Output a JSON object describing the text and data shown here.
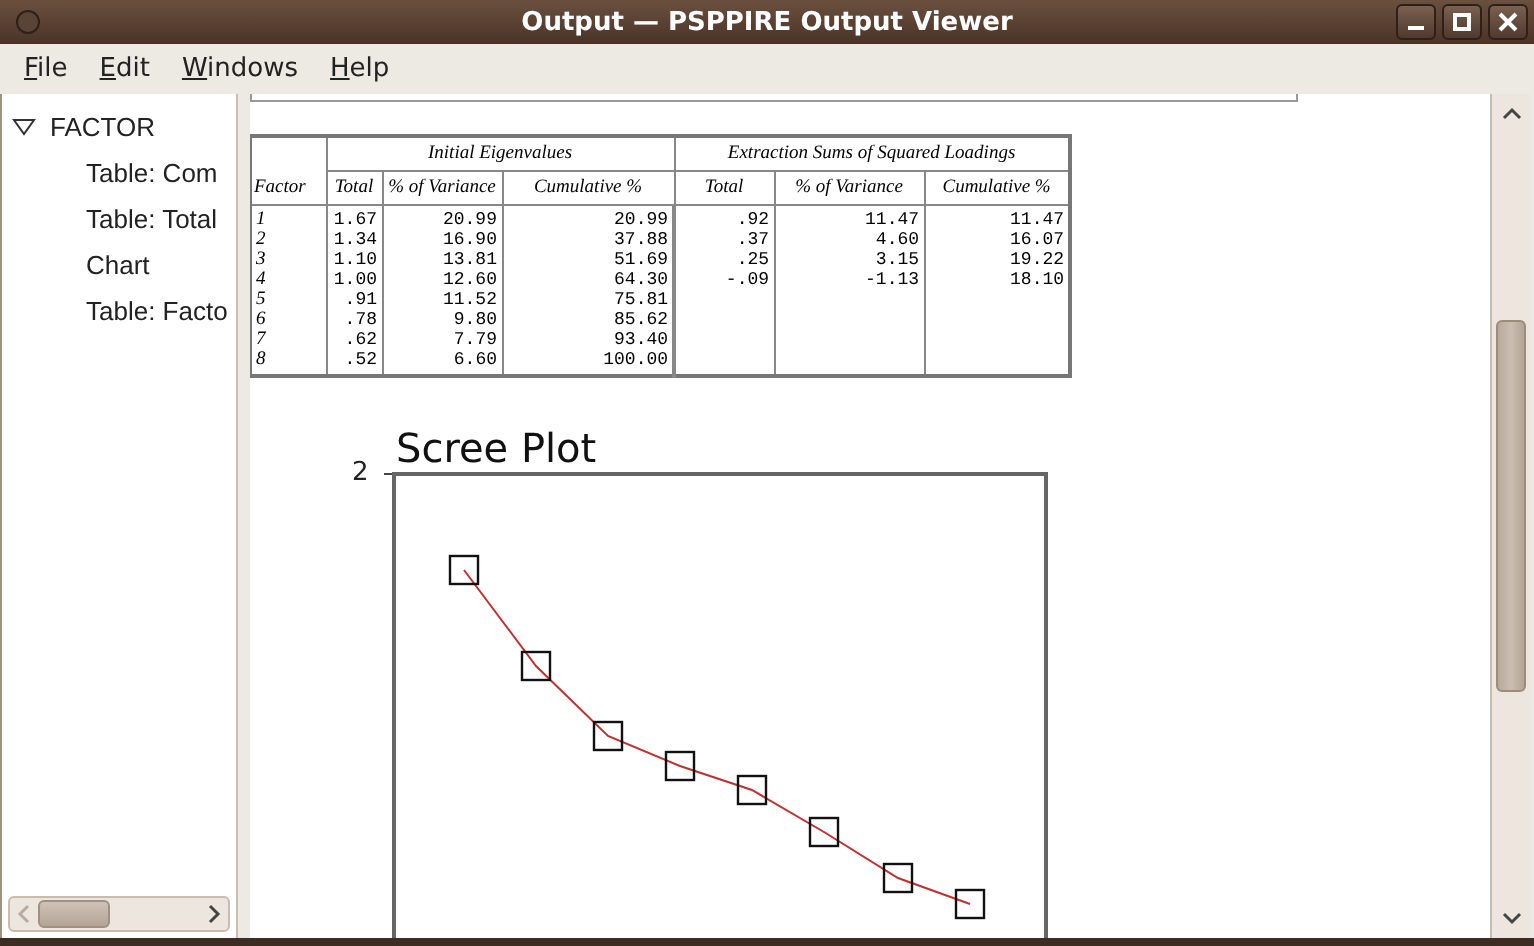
{
  "window": {
    "title": "Output — PSPPIRE Output Viewer"
  },
  "menu": [
    "File",
    "Edit",
    "Windows",
    "Help"
  ],
  "outline": [
    {
      "label": "FACTOR",
      "expanded": true,
      "children": [
        {
          "label": "Table: Com"
        },
        {
          "label": "Table: Total"
        },
        {
          "label": "Chart"
        },
        {
          "label": "Table: Facto"
        }
      ]
    }
  ],
  "table": {
    "group_headers": [
      "Initial Eigenvalues",
      "Extraction Sums of Squared Loadings"
    ],
    "columns": [
      "Factor",
      "Total",
      "% of Variance",
      "Cumulative %",
      "Total",
      "% of Variance",
      "Cumulative %"
    ],
    "rows": [
      [
        "1",
        "1.67",
        "20.99",
        "20.99",
        ".92",
        "11.47",
        "11.47"
      ],
      [
        "2",
        "1.34",
        "16.90",
        "37.88",
        ".37",
        "4.60",
        "16.07"
      ],
      [
        "3",
        "1.10",
        "13.81",
        "51.69",
        ".25",
        "3.15",
        "19.22"
      ],
      [
        "4",
        "1.00",
        "12.60",
        "64.30",
        "-.09",
        "-1.13",
        "18.10"
      ],
      [
        "5",
        ".91",
        "11.52",
        "75.81",
        "",
        "",
        ""
      ],
      [
        "6",
        ".78",
        "9.80",
        "85.62",
        "",
        "",
        ""
      ],
      [
        "7",
        ".62",
        "7.79",
        "93.40",
        "",
        "",
        ""
      ],
      [
        "8",
        ".52",
        "6.60",
        "100.00",
        "",
        "",
        ""
      ]
    ]
  },
  "chart": {
    "title": "Scree Plot",
    "y_tick": "2"
  }
}
